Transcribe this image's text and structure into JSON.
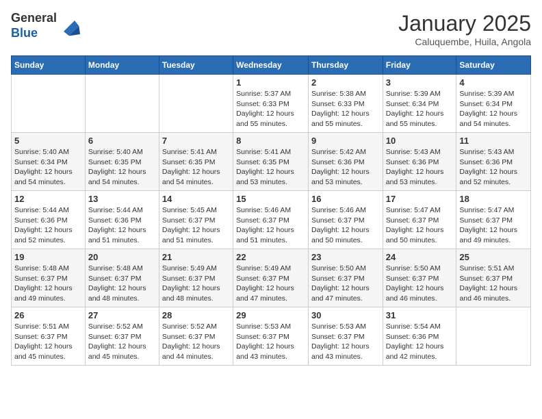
{
  "header": {
    "logo_line1": "General",
    "logo_line2": "Blue",
    "month": "January 2025",
    "location": "Caluquembe, Huila, Angola"
  },
  "weekdays": [
    "Sunday",
    "Monday",
    "Tuesday",
    "Wednesday",
    "Thursday",
    "Friday",
    "Saturday"
  ],
  "weeks": [
    [
      {
        "day": "",
        "detail": ""
      },
      {
        "day": "",
        "detail": ""
      },
      {
        "day": "",
        "detail": ""
      },
      {
        "day": "1",
        "detail": "Sunrise: 5:37 AM\nSunset: 6:33 PM\nDaylight: 12 hours\nand 55 minutes."
      },
      {
        "day": "2",
        "detail": "Sunrise: 5:38 AM\nSunset: 6:33 PM\nDaylight: 12 hours\nand 55 minutes."
      },
      {
        "day": "3",
        "detail": "Sunrise: 5:39 AM\nSunset: 6:34 PM\nDaylight: 12 hours\nand 55 minutes."
      },
      {
        "day": "4",
        "detail": "Sunrise: 5:39 AM\nSunset: 6:34 PM\nDaylight: 12 hours\nand 54 minutes."
      }
    ],
    [
      {
        "day": "5",
        "detail": "Sunrise: 5:40 AM\nSunset: 6:34 PM\nDaylight: 12 hours\nand 54 minutes."
      },
      {
        "day": "6",
        "detail": "Sunrise: 5:40 AM\nSunset: 6:35 PM\nDaylight: 12 hours\nand 54 minutes."
      },
      {
        "day": "7",
        "detail": "Sunrise: 5:41 AM\nSunset: 6:35 PM\nDaylight: 12 hours\nand 54 minutes."
      },
      {
        "day": "8",
        "detail": "Sunrise: 5:41 AM\nSunset: 6:35 PM\nDaylight: 12 hours\nand 53 minutes."
      },
      {
        "day": "9",
        "detail": "Sunrise: 5:42 AM\nSunset: 6:36 PM\nDaylight: 12 hours\nand 53 minutes."
      },
      {
        "day": "10",
        "detail": "Sunrise: 5:43 AM\nSunset: 6:36 PM\nDaylight: 12 hours\nand 53 minutes."
      },
      {
        "day": "11",
        "detail": "Sunrise: 5:43 AM\nSunset: 6:36 PM\nDaylight: 12 hours\nand 52 minutes."
      }
    ],
    [
      {
        "day": "12",
        "detail": "Sunrise: 5:44 AM\nSunset: 6:36 PM\nDaylight: 12 hours\nand 52 minutes."
      },
      {
        "day": "13",
        "detail": "Sunrise: 5:44 AM\nSunset: 6:36 PM\nDaylight: 12 hours\nand 51 minutes."
      },
      {
        "day": "14",
        "detail": "Sunrise: 5:45 AM\nSunset: 6:37 PM\nDaylight: 12 hours\nand 51 minutes."
      },
      {
        "day": "15",
        "detail": "Sunrise: 5:46 AM\nSunset: 6:37 PM\nDaylight: 12 hours\nand 51 minutes."
      },
      {
        "day": "16",
        "detail": "Sunrise: 5:46 AM\nSunset: 6:37 PM\nDaylight: 12 hours\nand 50 minutes."
      },
      {
        "day": "17",
        "detail": "Sunrise: 5:47 AM\nSunset: 6:37 PM\nDaylight: 12 hours\nand 50 minutes."
      },
      {
        "day": "18",
        "detail": "Sunrise: 5:47 AM\nSunset: 6:37 PM\nDaylight: 12 hours\nand 49 minutes."
      }
    ],
    [
      {
        "day": "19",
        "detail": "Sunrise: 5:48 AM\nSunset: 6:37 PM\nDaylight: 12 hours\nand 49 minutes."
      },
      {
        "day": "20",
        "detail": "Sunrise: 5:48 AM\nSunset: 6:37 PM\nDaylight: 12 hours\nand 48 minutes."
      },
      {
        "day": "21",
        "detail": "Sunrise: 5:49 AM\nSunset: 6:37 PM\nDaylight: 12 hours\nand 48 minutes."
      },
      {
        "day": "22",
        "detail": "Sunrise: 5:49 AM\nSunset: 6:37 PM\nDaylight: 12 hours\nand 47 minutes."
      },
      {
        "day": "23",
        "detail": "Sunrise: 5:50 AM\nSunset: 6:37 PM\nDaylight: 12 hours\nand 47 minutes."
      },
      {
        "day": "24",
        "detail": "Sunrise: 5:50 AM\nSunset: 6:37 PM\nDaylight: 12 hours\nand 46 minutes."
      },
      {
        "day": "25",
        "detail": "Sunrise: 5:51 AM\nSunset: 6:37 PM\nDaylight: 12 hours\nand 46 minutes."
      }
    ],
    [
      {
        "day": "26",
        "detail": "Sunrise: 5:51 AM\nSunset: 6:37 PM\nDaylight: 12 hours\nand 45 minutes."
      },
      {
        "day": "27",
        "detail": "Sunrise: 5:52 AM\nSunset: 6:37 PM\nDaylight: 12 hours\nand 45 minutes."
      },
      {
        "day": "28",
        "detail": "Sunrise: 5:52 AM\nSunset: 6:37 PM\nDaylight: 12 hours\nand 44 minutes."
      },
      {
        "day": "29",
        "detail": "Sunrise: 5:53 AM\nSunset: 6:37 PM\nDaylight: 12 hours\nand 43 minutes."
      },
      {
        "day": "30",
        "detail": "Sunrise: 5:53 AM\nSunset: 6:37 PM\nDaylight: 12 hours\nand 43 minutes."
      },
      {
        "day": "31",
        "detail": "Sunrise: 5:54 AM\nSunset: 6:36 PM\nDaylight: 12 hours\nand 42 minutes."
      },
      {
        "day": "",
        "detail": ""
      }
    ]
  ]
}
